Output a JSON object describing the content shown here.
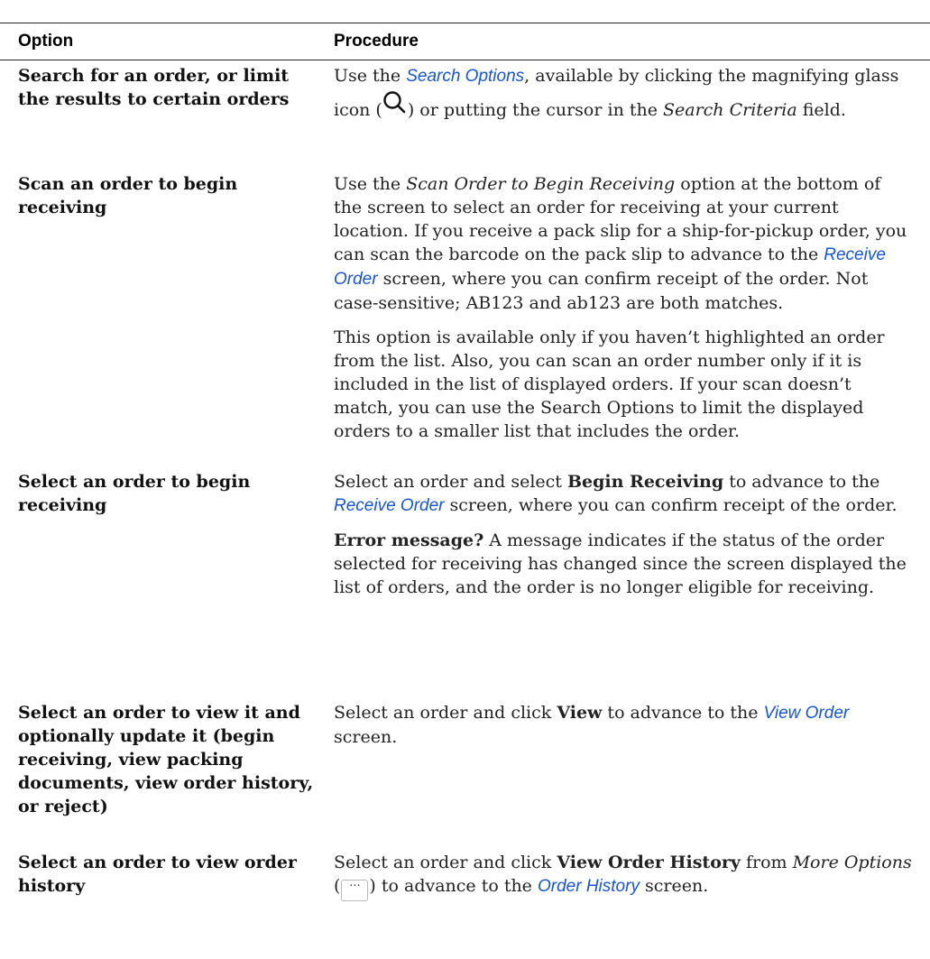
{
  "table": {
    "headers": {
      "option": "Option",
      "procedure": "Procedure"
    },
    "row1": {
      "option": "Search for an order, or limit the results to certain orders",
      "t1": "Use the ",
      "link1": "Search Options",
      "t2": ", available by clicking the magnifying glass icon (",
      "t3": ") or putting the cursor in the ",
      "em1": "Search Criteria",
      "t4": " field.",
      "icon": "search-icon"
    },
    "row2": {
      "option": "Scan an order to begin receiving",
      "p1_t1": "Use the ",
      "p1_em1": "Scan Order to Begin Receiving",
      "p1_t2": " option at the bottom of the screen to select an order for receiving at your current location. If you receive a pack slip for a ship-for-pickup order, you can scan the barcode on the pack slip to advance to the ",
      "p1_link1": "Receive Order",
      "p1_t3": " screen, where you can confirm receipt of the order. Not case-sensitive; AB123 and ab123 are both matches.",
      "p2": "This option is available only if you haven’t highlighted an order from the list. Also, you can scan an order number only if it is included in the list of displayed orders. If your scan doesn’t match, you can use the Search Options to limit the displayed orders to a smaller list that includes the order."
    },
    "row3": {
      "option": "Select an order to begin receiving",
      "p1_t1": "Select an order and select ",
      "p1_b1": "Begin Receiving",
      "p1_t2": " to advance to the ",
      "p1_link1": "Receive Order",
      "p1_t3": " screen, where you can confirm receipt of the order.",
      "p2_b1": "Error message?",
      "p2_t1": " A message indicates if the status of the order selected for receiving has changed since the screen displayed the list of orders, and the order is no longer eligible for receiving."
    },
    "row4": {
      "option": "Select an order to view it and optionally update it (begin receiving, view packing documents, view order history, or reject)",
      "t1": "Select an order and click ",
      "b1": "View",
      "t2": " to advance to the ",
      "link1": "View Order",
      "t3": " screen."
    },
    "row5": {
      "option": "Select an order to view order history",
      "t1": "Select an order and click ",
      "b1": "View Order History",
      "t2": " from ",
      "em1": "More Options",
      "t3": " (",
      "icon_text": "···",
      "t4": ") to advance to the ",
      "link1": "Order History",
      "t5": " screen."
    }
  },
  "colors": {
    "link": "#1a55c9",
    "rule": "#222222"
  }
}
